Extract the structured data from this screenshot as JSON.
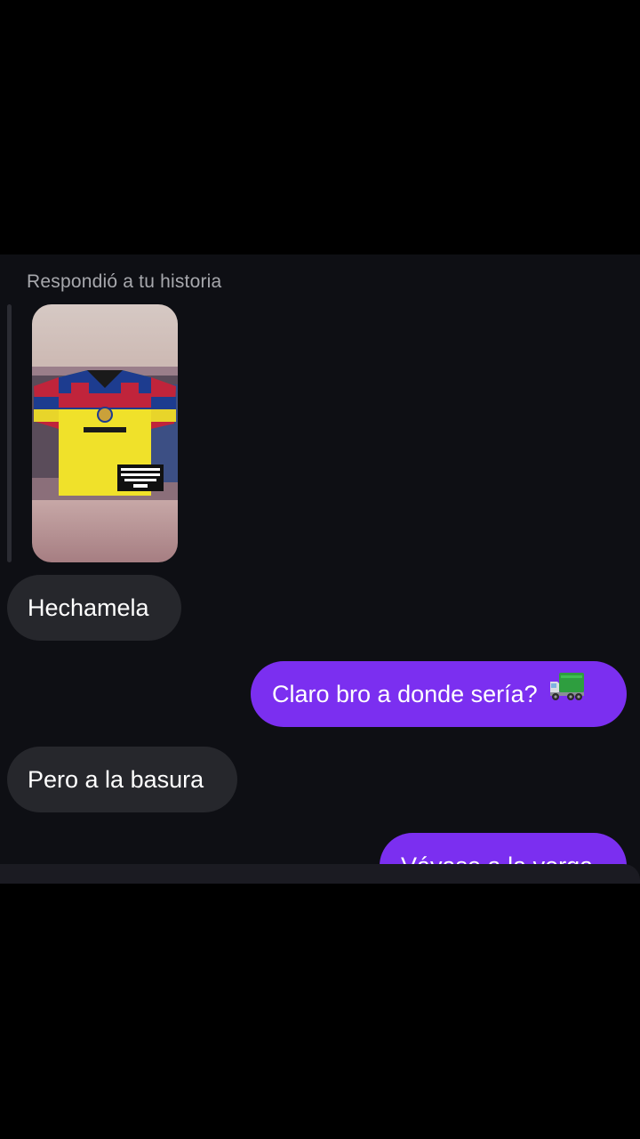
{
  "chat": {
    "reply_label": "Respondió a tu historia",
    "story_image": {
      "description_icon": "jersey-photo",
      "tag_lines": [
        "Playera 25-26",
        "Versión jugador",
        "Talla - M",
        "$800"
      ]
    },
    "messages": [
      {
        "direction": "received",
        "text": "Hechamela"
      },
      {
        "direction": "sent",
        "text": "Claro bro a donde sería?",
        "icon": "truck-emoji"
      },
      {
        "direction": "received",
        "text": "Pero a la basura"
      },
      {
        "direction": "sent",
        "text": "Váyase a la verga"
      }
    ]
  },
  "colors": {
    "background": "#0e0f14",
    "received_bubble": "#26272c",
    "sent_bubble": "#7b2ff0",
    "label_gray": "#a7a8ad"
  }
}
